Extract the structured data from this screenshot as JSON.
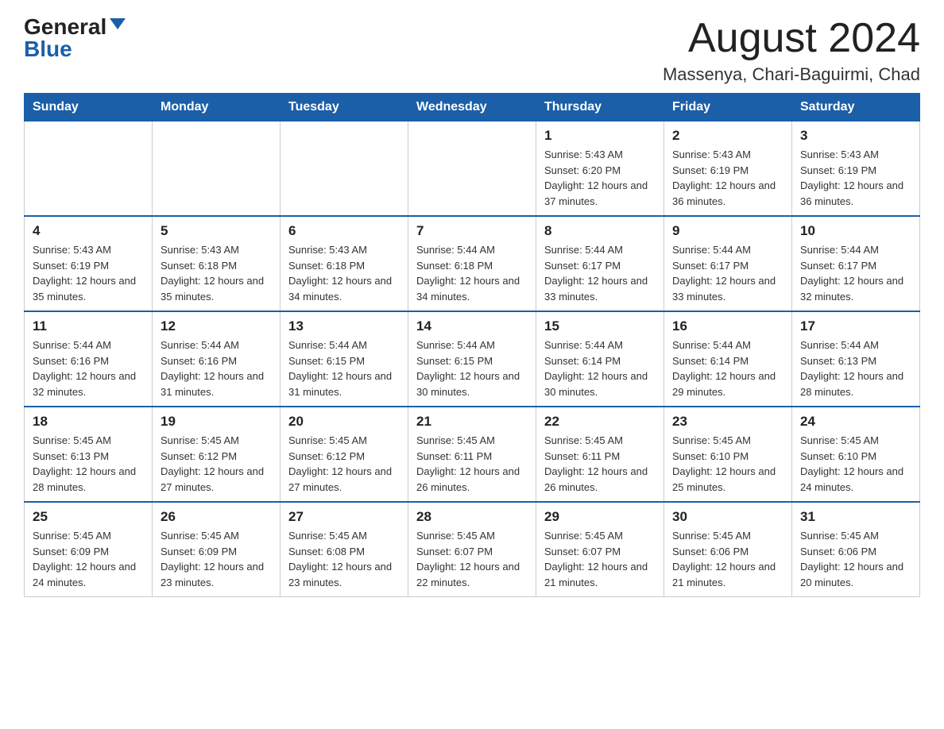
{
  "header": {
    "logo_general": "General",
    "logo_blue": "Blue",
    "month": "August 2024",
    "location": "Massenya, Chari-Baguirmi, Chad"
  },
  "weekdays": [
    "Sunday",
    "Monday",
    "Tuesday",
    "Wednesday",
    "Thursday",
    "Friday",
    "Saturday"
  ],
  "weeks": [
    [
      {
        "day": "",
        "sunrise": "",
        "sunset": "",
        "daylight": ""
      },
      {
        "day": "",
        "sunrise": "",
        "sunset": "",
        "daylight": ""
      },
      {
        "day": "",
        "sunrise": "",
        "sunset": "",
        "daylight": ""
      },
      {
        "day": "",
        "sunrise": "",
        "sunset": "",
        "daylight": ""
      },
      {
        "day": "1",
        "sunrise": "Sunrise: 5:43 AM",
        "sunset": "Sunset: 6:20 PM",
        "daylight": "Daylight: 12 hours and 37 minutes."
      },
      {
        "day": "2",
        "sunrise": "Sunrise: 5:43 AM",
        "sunset": "Sunset: 6:19 PM",
        "daylight": "Daylight: 12 hours and 36 minutes."
      },
      {
        "day": "3",
        "sunrise": "Sunrise: 5:43 AM",
        "sunset": "Sunset: 6:19 PM",
        "daylight": "Daylight: 12 hours and 36 minutes."
      }
    ],
    [
      {
        "day": "4",
        "sunrise": "Sunrise: 5:43 AM",
        "sunset": "Sunset: 6:19 PM",
        "daylight": "Daylight: 12 hours and 35 minutes."
      },
      {
        "day": "5",
        "sunrise": "Sunrise: 5:43 AM",
        "sunset": "Sunset: 6:18 PM",
        "daylight": "Daylight: 12 hours and 35 minutes."
      },
      {
        "day": "6",
        "sunrise": "Sunrise: 5:43 AM",
        "sunset": "Sunset: 6:18 PM",
        "daylight": "Daylight: 12 hours and 34 minutes."
      },
      {
        "day": "7",
        "sunrise": "Sunrise: 5:44 AM",
        "sunset": "Sunset: 6:18 PM",
        "daylight": "Daylight: 12 hours and 34 minutes."
      },
      {
        "day": "8",
        "sunrise": "Sunrise: 5:44 AM",
        "sunset": "Sunset: 6:17 PM",
        "daylight": "Daylight: 12 hours and 33 minutes."
      },
      {
        "day": "9",
        "sunrise": "Sunrise: 5:44 AM",
        "sunset": "Sunset: 6:17 PM",
        "daylight": "Daylight: 12 hours and 33 minutes."
      },
      {
        "day": "10",
        "sunrise": "Sunrise: 5:44 AM",
        "sunset": "Sunset: 6:17 PM",
        "daylight": "Daylight: 12 hours and 32 minutes."
      }
    ],
    [
      {
        "day": "11",
        "sunrise": "Sunrise: 5:44 AM",
        "sunset": "Sunset: 6:16 PM",
        "daylight": "Daylight: 12 hours and 32 minutes."
      },
      {
        "day": "12",
        "sunrise": "Sunrise: 5:44 AM",
        "sunset": "Sunset: 6:16 PM",
        "daylight": "Daylight: 12 hours and 31 minutes."
      },
      {
        "day": "13",
        "sunrise": "Sunrise: 5:44 AM",
        "sunset": "Sunset: 6:15 PM",
        "daylight": "Daylight: 12 hours and 31 minutes."
      },
      {
        "day": "14",
        "sunrise": "Sunrise: 5:44 AM",
        "sunset": "Sunset: 6:15 PM",
        "daylight": "Daylight: 12 hours and 30 minutes."
      },
      {
        "day": "15",
        "sunrise": "Sunrise: 5:44 AM",
        "sunset": "Sunset: 6:14 PM",
        "daylight": "Daylight: 12 hours and 30 minutes."
      },
      {
        "day": "16",
        "sunrise": "Sunrise: 5:44 AM",
        "sunset": "Sunset: 6:14 PM",
        "daylight": "Daylight: 12 hours and 29 minutes."
      },
      {
        "day": "17",
        "sunrise": "Sunrise: 5:44 AM",
        "sunset": "Sunset: 6:13 PM",
        "daylight": "Daylight: 12 hours and 28 minutes."
      }
    ],
    [
      {
        "day": "18",
        "sunrise": "Sunrise: 5:45 AM",
        "sunset": "Sunset: 6:13 PM",
        "daylight": "Daylight: 12 hours and 28 minutes."
      },
      {
        "day": "19",
        "sunrise": "Sunrise: 5:45 AM",
        "sunset": "Sunset: 6:12 PM",
        "daylight": "Daylight: 12 hours and 27 minutes."
      },
      {
        "day": "20",
        "sunrise": "Sunrise: 5:45 AM",
        "sunset": "Sunset: 6:12 PM",
        "daylight": "Daylight: 12 hours and 27 minutes."
      },
      {
        "day": "21",
        "sunrise": "Sunrise: 5:45 AM",
        "sunset": "Sunset: 6:11 PM",
        "daylight": "Daylight: 12 hours and 26 minutes."
      },
      {
        "day": "22",
        "sunrise": "Sunrise: 5:45 AM",
        "sunset": "Sunset: 6:11 PM",
        "daylight": "Daylight: 12 hours and 26 minutes."
      },
      {
        "day": "23",
        "sunrise": "Sunrise: 5:45 AM",
        "sunset": "Sunset: 6:10 PM",
        "daylight": "Daylight: 12 hours and 25 minutes."
      },
      {
        "day": "24",
        "sunrise": "Sunrise: 5:45 AM",
        "sunset": "Sunset: 6:10 PM",
        "daylight": "Daylight: 12 hours and 24 minutes."
      }
    ],
    [
      {
        "day": "25",
        "sunrise": "Sunrise: 5:45 AM",
        "sunset": "Sunset: 6:09 PM",
        "daylight": "Daylight: 12 hours and 24 minutes."
      },
      {
        "day": "26",
        "sunrise": "Sunrise: 5:45 AM",
        "sunset": "Sunset: 6:09 PM",
        "daylight": "Daylight: 12 hours and 23 minutes."
      },
      {
        "day": "27",
        "sunrise": "Sunrise: 5:45 AM",
        "sunset": "Sunset: 6:08 PM",
        "daylight": "Daylight: 12 hours and 23 minutes."
      },
      {
        "day": "28",
        "sunrise": "Sunrise: 5:45 AM",
        "sunset": "Sunset: 6:07 PM",
        "daylight": "Daylight: 12 hours and 22 minutes."
      },
      {
        "day": "29",
        "sunrise": "Sunrise: 5:45 AM",
        "sunset": "Sunset: 6:07 PM",
        "daylight": "Daylight: 12 hours and 21 minutes."
      },
      {
        "day": "30",
        "sunrise": "Sunrise: 5:45 AM",
        "sunset": "Sunset: 6:06 PM",
        "daylight": "Daylight: 12 hours and 21 minutes."
      },
      {
        "day": "31",
        "sunrise": "Sunrise: 5:45 AM",
        "sunset": "Sunset: 6:06 PM",
        "daylight": "Daylight: 12 hours and 20 minutes."
      }
    ]
  ]
}
